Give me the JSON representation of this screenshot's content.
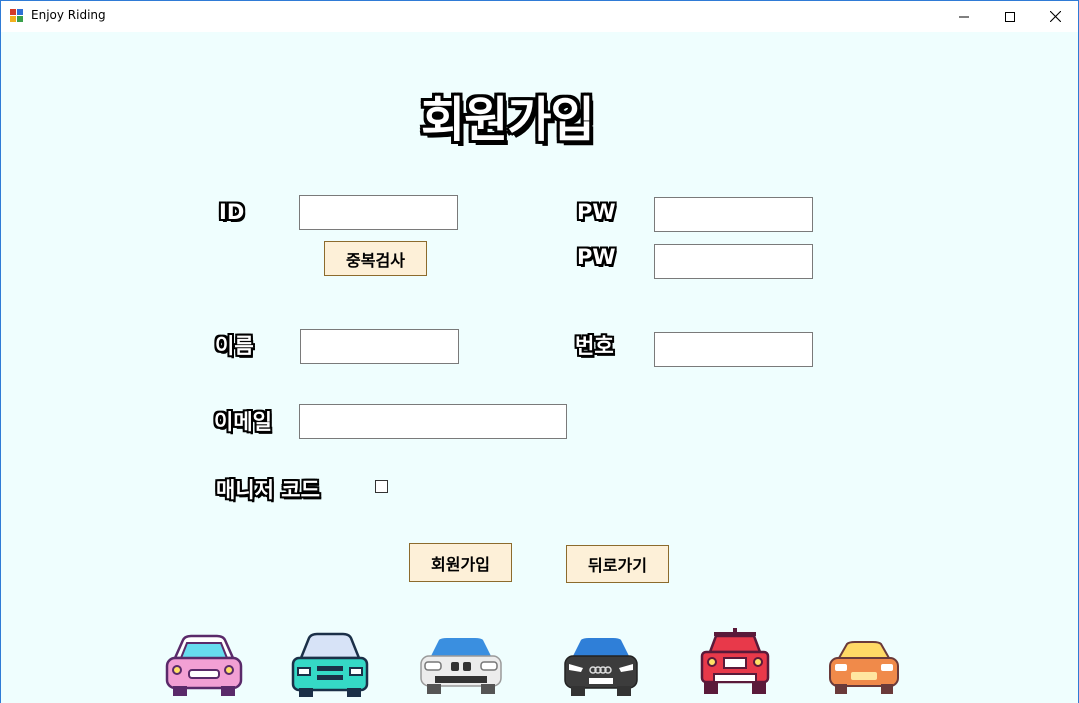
{
  "window": {
    "title": "Enjoy Riding",
    "controls": {
      "minimize": "minimize-icon",
      "maximize": "maximize-icon",
      "close": "close-icon"
    }
  },
  "form": {
    "heading": "회원가입",
    "id_label": "ID",
    "id_value": "",
    "dup_check_label": "중복검사",
    "pw_label": "PW",
    "pw_value": "",
    "pw_confirm_label": "PW",
    "pw_confirm_value": "",
    "name_label": "이름",
    "name_value": "",
    "phone_label": "번호",
    "phone_value": "",
    "email_label": "이메일",
    "email_value": "",
    "manager_code_label": "매니저 코드",
    "manager_code_checked": false,
    "signup_label": "회원가입",
    "back_label": "뒤로가기"
  },
  "cars": [
    "pink-car-icon",
    "teal-car-icon",
    "blue-white-car-icon",
    "blue-dark-car-icon",
    "red-jeep-icon",
    "orange-car-icon"
  ],
  "colors": {
    "background": "#effefe",
    "button": "#fdf0d8",
    "button_border": "#8c6b2d"
  }
}
